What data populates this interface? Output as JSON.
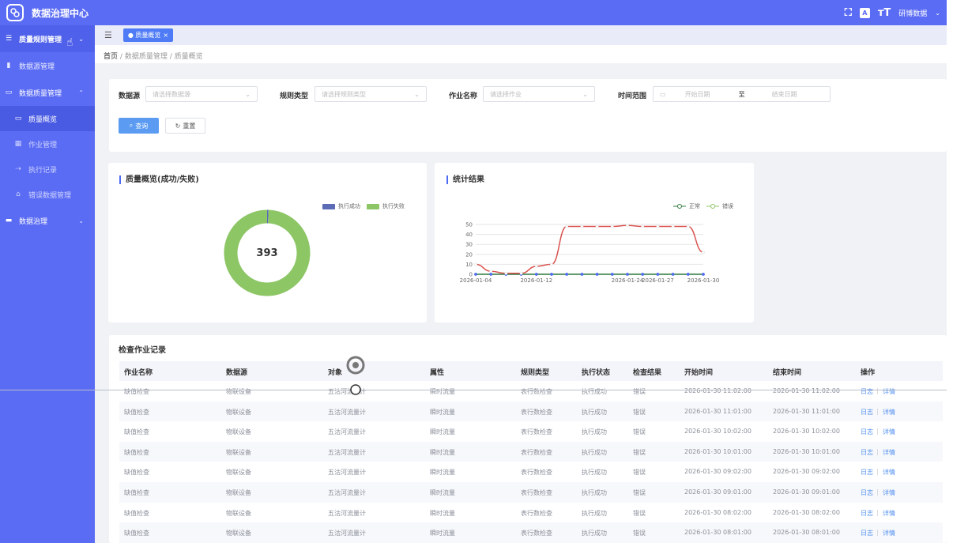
{
  "app": {
    "title": "数据治理中心",
    "user": "研博数据"
  },
  "colors": {
    "primary": "#5b6cf4",
    "success": "#8cc665",
    "fail": "#5b6bb6",
    "line_normal": "#2f7a3e",
    "line_error": "#d9534f"
  },
  "sidebar": {
    "items": [
      {
        "label": "质量规则管理",
        "icon": "list-icon"
      },
      {
        "label": "数据源管理",
        "icon": "bar-chart-icon"
      },
      {
        "label": "数据质量管理",
        "icon": "monitor-icon"
      },
      {
        "label": "质量概览",
        "icon": "monitor-icon"
      },
      {
        "label": "作业管理",
        "icon": "grid-icon"
      },
      {
        "label": "执行记录",
        "icon": "arrow-icon"
      },
      {
        "label": "错误数据管理",
        "icon": "home-icon"
      },
      {
        "label": "数据治理",
        "icon": "folder-icon"
      }
    ]
  },
  "tabbar": {
    "active_tab": "● 质量概览",
    "close": "×"
  },
  "breadcrumb": {
    "home": "首页",
    "sep": "/",
    "level1": "数据质量管理",
    "level2": "质量概览"
  },
  "filters": {
    "datasource_label": "数据源",
    "datasource_placeholder": "请选择数据源",
    "ruletype_label": "规则类型",
    "ruletype_placeholder": "请选择规则类型",
    "job_label": "作业名称",
    "job_placeholder": "请选择作业",
    "time_label": "时间范围",
    "start_placeholder": "开始日期",
    "to": "至",
    "end_placeholder": "结束日期",
    "query_btn": "查询",
    "reset_btn": "重置"
  },
  "donut_card": {
    "title": "质量概览(成功/失败)",
    "legend_success": "执行成功",
    "legend_fail": "执行失败",
    "center_value": "393"
  },
  "stats_card": {
    "title": "统计结果",
    "legend_normal": "正常",
    "legend_error": "错误"
  },
  "chart_data": [
    {
      "type": "pie",
      "title": "质量概览(成功/失败)",
      "categories": [
        "执行成功",
        "执行失败"
      ],
      "values": [
        2,
        391
      ],
      "total": 393
    },
    {
      "type": "line",
      "title": "统计结果",
      "x": [
        "2026-01-04",
        "2026-01-06",
        "2026-01-08",
        "2026-01-10",
        "2026-01-12",
        "2026-01-14",
        "2026-01-16",
        "2026-01-18",
        "2026-01-20",
        "2026-01-22",
        "2026-01-24",
        "2026-01-26",
        "2026-01-27",
        "2026-01-28",
        "2026-01-29",
        "2026-01-30"
      ],
      "x_ticks": [
        "2026-01-04",
        "2026-01-12",
        "2026-01-24",
        "2026-01-27",
        "2026-01-30"
      ],
      "ylim": [
        0,
        50
      ],
      "y_ticks": [
        0,
        10,
        20,
        30,
        40,
        50
      ],
      "series": [
        {
          "name": "正常",
          "values": [
            0,
            0,
            0,
            0,
            0,
            0,
            0,
            0,
            0,
            0,
            0,
            0,
            0,
            0,
            0,
            0
          ]
        },
        {
          "name": "错误",
          "values": [
            10,
            3,
            1,
            1,
            8,
            10,
            48,
            48,
            48,
            48,
            49,
            48,
            48,
            48,
            48,
            22
          ]
        }
      ]
    }
  ],
  "table": {
    "title": "检查作业记录",
    "columns": [
      "作业名称",
      "数据源",
      "对象",
      "属性",
      "规则类型",
      "执行状态",
      "检查结果",
      "开始时间",
      "结束时间",
      "操作"
    ],
    "action_log": "日志",
    "action_detail": "详情",
    "rows": [
      [
        "缺值检查",
        "物联设备",
        "五沽河流量计",
        "瞬时流量",
        "表行数检查",
        "执行成功",
        "错误",
        "2026-01-30 11:02:00",
        "2026-01-30 11:02:00"
      ],
      [
        "缺值检查",
        "物联设备",
        "五沽河流量计",
        "瞬时流量",
        "表行数检查",
        "执行成功",
        "错误",
        "2026-01-30 11:01:00",
        "2026-01-30 11:01:00"
      ],
      [
        "缺值检查",
        "物联设备",
        "五沽河流量计",
        "瞬时流量",
        "表行数检查",
        "执行成功",
        "错误",
        "2026-01-30 10:02:00",
        "2026-01-30 10:02:00"
      ],
      [
        "缺值检查",
        "物联设备",
        "五沽河流量计",
        "瞬时流量",
        "表行数检查",
        "执行成功",
        "错误",
        "2026-01-30 10:01:00",
        "2026-01-30 10:01:00"
      ],
      [
        "缺值检查",
        "物联设备",
        "五沽河流量计",
        "瞬时流量",
        "表行数检查",
        "执行成功",
        "错误",
        "2026-01-30 09:02:00",
        "2026-01-30 09:02:00"
      ],
      [
        "缺值检查",
        "物联设备",
        "五沽河流量计",
        "瞬时流量",
        "表行数检查",
        "执行成功",
        "错误",
        "2026-01-30 09:01:00",
        "2026-01-30 09:01:00"
      ],
      [
        "缺值检查",
        "物联设备",
        "五沽河流量计",
        "瞬时流量",
        "表行数检查",
        "执行成功",
        "错误",
        "2026-01-30 08:02:00",
        "2026-01-30 08:02:00"
      ],
      [
        "缺值检查",
        "物联设备",
        "五沽河流量计",
        "瞬时流量",
        "表行数检查",
        "执行成功",
        "错误",
        "2026-01-30 08:01:00",
        "2026-01-30 08:01:00"
      ]
    ]
  }
}
